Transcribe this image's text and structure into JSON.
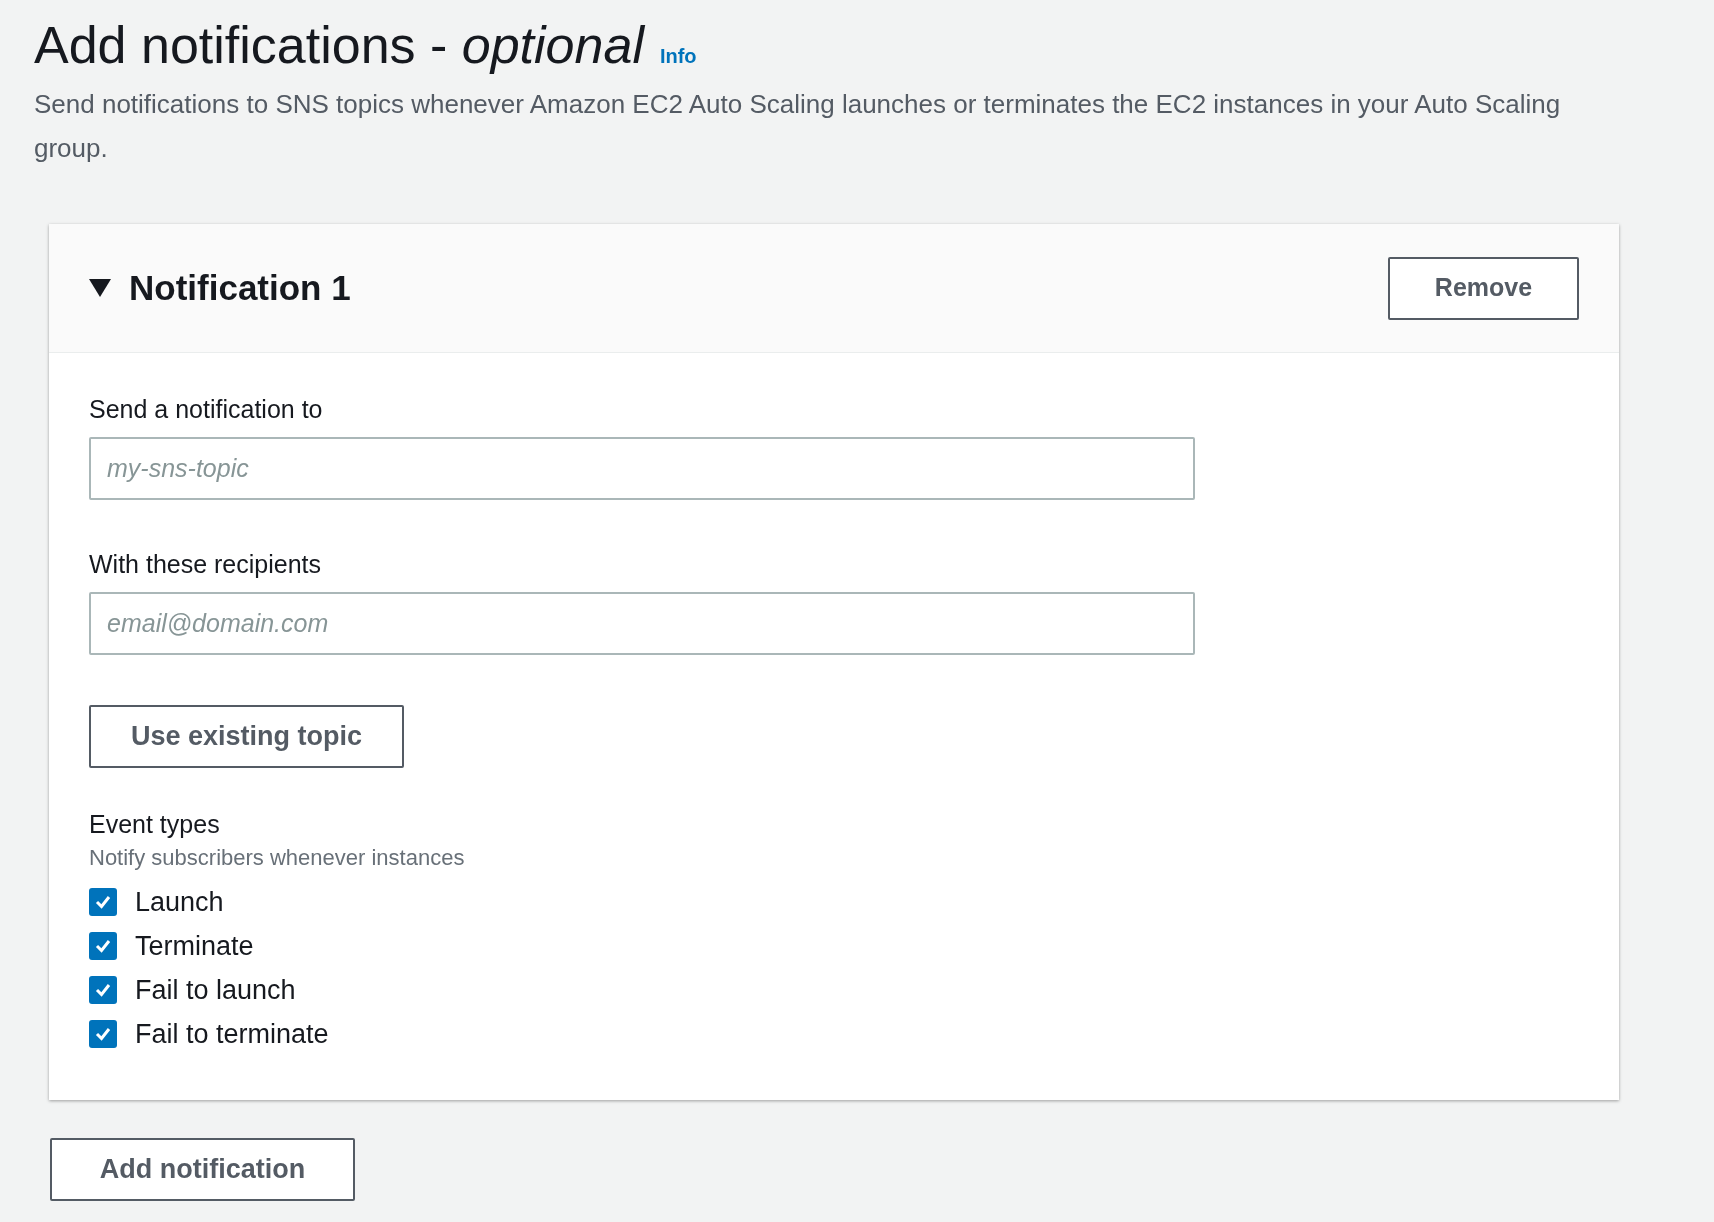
{
  "header": {
    "title": "Add notifications - ",
    "title_emphasis": "optional",
    "info_link": "Info",
    "description": "Send notifications to SNS topics whenever Amazon EC2 Auto Scaling launches or terminates the EC2 instances in your Auto Scaling group."
  },
  "notifications": [
    {
      "title": "Notification 1",
      "expanded": true,
      "remove_button": "Remove",
      "topic": {
        "label": "Send a notification to",
        "placeholder": "my-sns-topic"
      },
      "recipients": {
        "label": "With these recipients",
        "placeholder": "email@domain.com"
      },
      "existing_topic_button": "Use existing topic",
      "event_types": {
        "label": "Event types",
        "description": "Notify subscribers whenever instances",
        "options": [
          {
            "label": "Launch",
            "checked": true
          },
          {
            "label": "Terminate",
            "checked": true
          },
          {
            "label": "Fail to launch",
            "checked": true
          },
          {
            "label": "Fail to terminate",
            "checked": true
          }
        ]
      }
    }
  ],
  "add_button": "Add notification"
}
